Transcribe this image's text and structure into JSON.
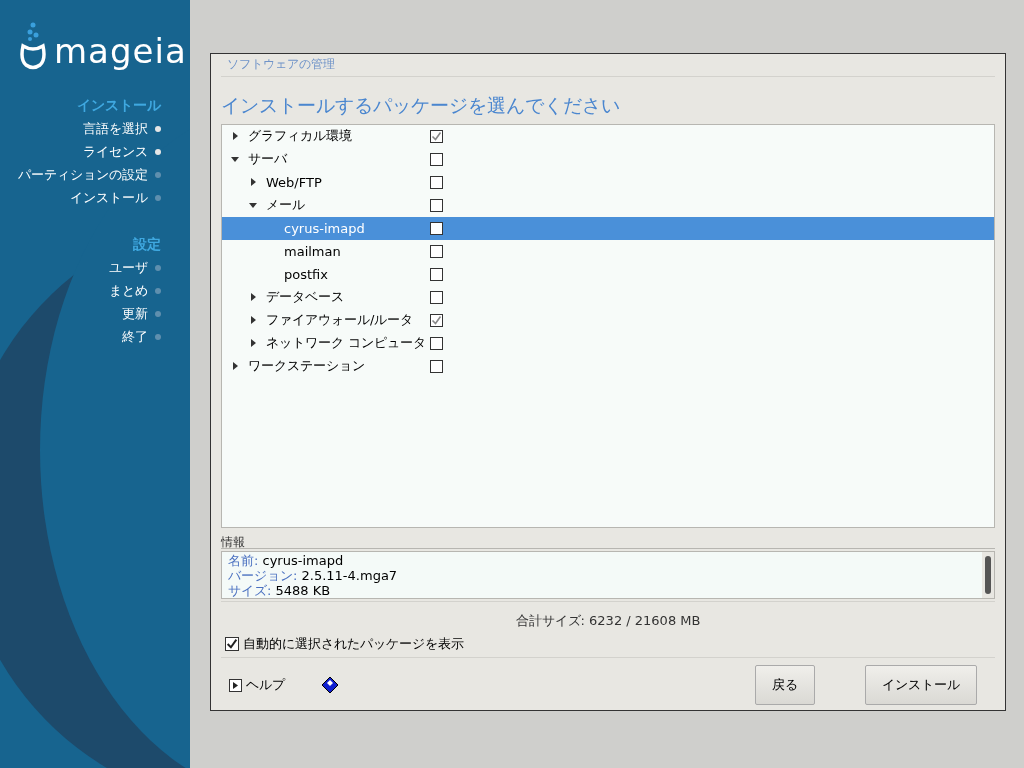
{
  "logo": {
    "text": "mageia"
  },
  "sidebar": {
    "sections": [
      {
        "title": "インストール",
        "steps": [
          {
            "label": "言語を選択",
            "done": true
          },
          {
            "label": "ライセンス",
            "done": true
          },
          {
            "label": "パーティションの設定",
            "done": false
          },
          {
            "label": "インストール",
            "done": false
          }
        ]
      },
      {
        "title": "設定",
        "steps": [
          {
            "label": "ユーザ",
            "done": false
          },
          {
            "label": "まとめ",
            "done": false
          },
          {
            "label": "更新",
            "done": false
          },
          {
            "label": "終了",
            "done": false
          }
        ]
      }
    ]
  },
  "window": {
    "title": "ソフトウェアの管理"
  },
  "heading": "インストールするパッケージを選んでください",
  "tree": [
    {
      "label": "グラフィカル環境",
      "checked": true,
      "selected": false,
      "expanded": false
    },
    {
      "label": "サーバ",
      "checked": false,
      "selected": false,
      "expanded": true,
      "children": [
        {
          "label": "Web/FTP",
          "checked": false,
          "selected": false,
          "expanded": false
        },
        {
          "label": "メール",
          "checked": false,
          "selected": false,
          "expanded": true,
          "children": [
            {
              "label": "cyrus-imapd",
              "checked": false,
              "selected": true
            },
            {
              "label": "mailman",
              "checked": false,
              "selected": false
            },
            {
              "label": "postfix",
              "checked": false,
              "selected": false
            }
          ]
        },
        {
          "label": "データベース",
          "checked": false,
          "selected": false,
          "expanded": false
        },
        {
          "label": "ファイアウォール/ルータ",
          "checked": true,
          "selected": false,
          "expanded": false
        },
        {
          "label": "ネットワーク コンピュータ",
          "checked": false,
          "selected": false,
          "expanded": false
        }
      ]
    },
    {
      "label": "ワークステーション",
      "checked": false,
      "selected": false,
      "expanded": false
    }
  ],
  "info": {
    "title": "情報",
    "lines": [
      {
        "key": "名前:",
        "value": "cyrus-imapd"
      },
      {
        "key": "バージョン:",
        "value": "2.5.11-4.mga7"
      },
      {
        "key": "サイズ:",
        "value": "5488 KB"
      }
    ]
  },
  "total_size": "合計サイズ: 6232 / 21608 MB",
  "show_auto": {
    "label": "自動的に選択されたパッケージを表示",
    "checked": true
  },
  "help": {
    "label": "ヘルプ",
    "expanded": false
  },
  "buttons": [
    "戻る",
    "インストール"
  ]
}
